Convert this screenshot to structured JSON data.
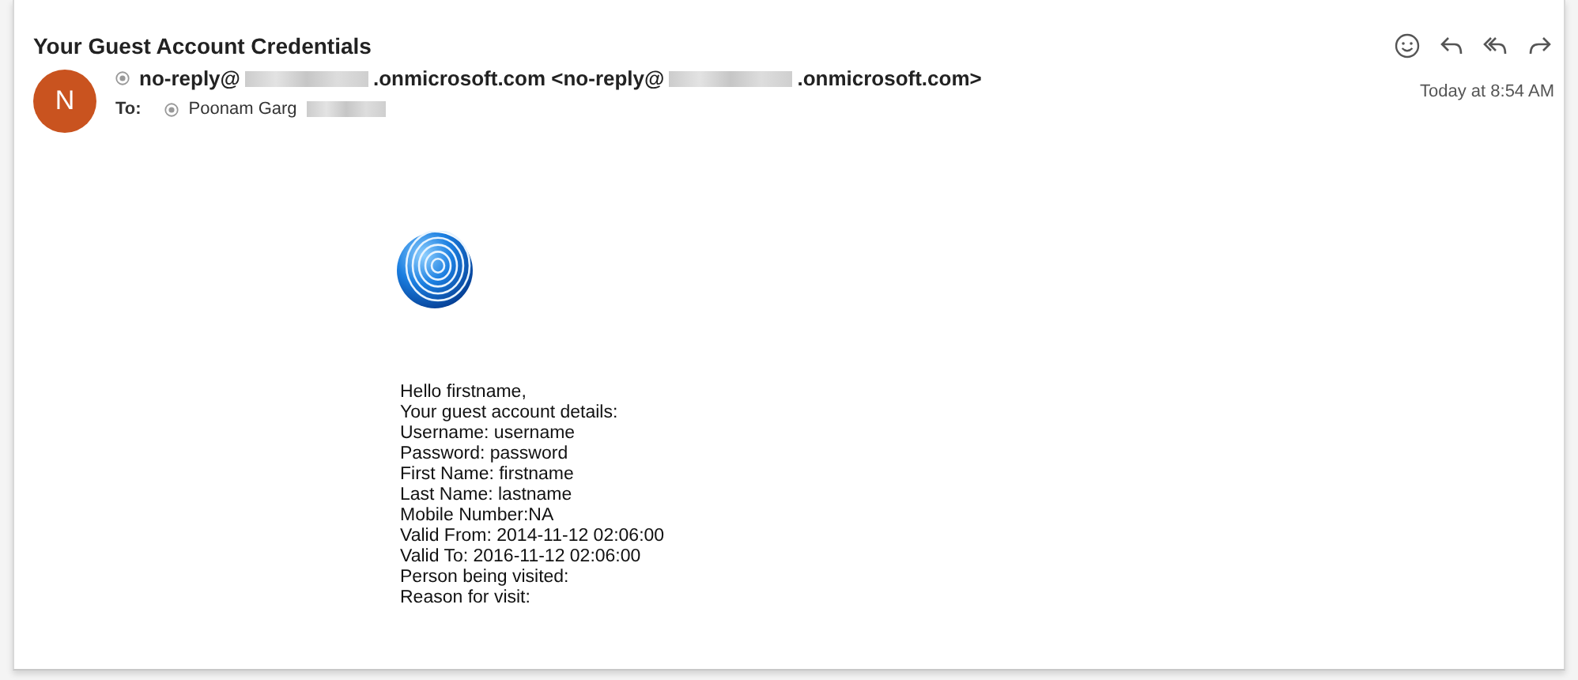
{
  "subject": "Your Guest Account Credentials",
  "sender": {
    "initial": "N",
    "segments": [
      {
        "kind": "text",
        "text": "no-reply@"
      },
      {
        "kind": "redacted"
      },
      {
        "kind": "text",
        "text": ".onmicrosoft.com <no-reply@"
      },
      {
        "kind": "redacted"
      },
      {
        "kind": "text",
        "text": ".onmicrosoft.com>"
      }
    ]
  },
  "to": {
    "label": "To:",
    "segments": [
      {
        "kind": "text",
        "text": "Poonam Garg"
      },
      {
        "kind": "redacted"
      }
    ]
  },
  "date": "Today at 8:54 AM",
  "body": [
    "Hello firstname,",
    "Your guest account details:",
    "Username: username",
    "Password: password",
    "First Name: firstname",
    "Last Name: lastname",
    "Mobile Number:NA",
    "Valid From: 2014-11-12 02:06:00",
    "Valid To: 2016-11-12 02:06:00",
    "Person being visited:",
    "Reason for visit:"
  ]
}
